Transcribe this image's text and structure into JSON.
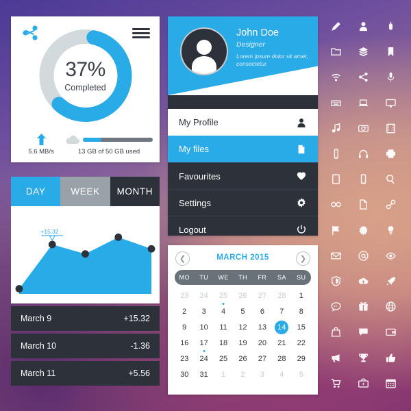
{
  "background": {
    "top_left": "#4b3a96",
    "top_right": "#8a79b5",
    "mid_right": "#cc9180",
    "bottom_right": "#6b2d6b",
    "bottom_left": "#4a2566"
  },
  "accent": "#29abe8",
  "dark": "#2c313a",
  "donut_card": {
    "share_icon": "share-icon",
    "menu_icon": "hamburger-menu-icon",
    "percent_text": "37%",
    "completed_label": "Completed",
    "percent_value": 37,
    "upload_icon": "upload-arrow-icon",
    "upload_speed": "5.6 MB/s",
    "cloud_icon": "cloud-icon",
    "storage_text": "13 GB of 50 GB used",
    "storage_used_gb": 13,
    "storage_total_gb": 50,
    "storage_percent": 26
  },
  "graph_card": {
    "tabs": [
      {
        "label": "DAY",
        "state": "active"
      },
      {
        "label": "WEEK",
        "state": "inactive"
      },
      {
        "label": "MONTH",
        "state": "dark"
      }
    ],
    "tooltip": "+15.32",
    "rows": [
      {
        "date": "March 9",
        "value": "+15.32"
      },
      {
        "date": "March 10",
        "value": "-1.36"
      },
      {
        "date": "March 11",
        "value": "+5.56"
      }
    ]
  },
  "chart_data": {
    "type": "area",
    "title": "",
    "xlabel": "",
    "ylabel": "",
    "x": [
      0,
      1,
      2,
      3,
      4
    ],
    "values": [
      7,
      68,
      55,
      78,
      62
    ],
    "point_labels": [
      "",
      "+15.32",
      "",
      "",
      ""
    ],
    "annotation": "+15.32",
    "grid": false,
    "legend": "none",
    "ylim": [
      0,
      100
    ],
    "series_color": "#29abe8",
    "marker_color": "#2c313a"
  },
  "profile_card": {
    "name": "John Doe",
    "role": "Designer",
    "description": "Lorem ipsum dolor sit amet, consectetur.",
    "avatar_icon": "user-avatar-icon",
    "menu": [
      {
        "label": "My Profile",
        "icon": "user-icon",
        "state": "white"
      },
      {
        "label": "My files",
        "icon": "file-icon",
        "state": "active"
      },
      {
        "label": "Favourites",
        "icon": "heart-icon",
        "state": "dark"
      },
      {
        "label": "Settings",
        "icon": "gear-icon",
        "state": "dark"
      },
      {
        "label": "Logout",
        "icon": "power-icon",
        "state": "dark"
      }
    ]
  },
  "calendar_card": {
    "title": "MARCH 2015",
    "prev_icon": "chevron-left-icon",
    "next_icon": "chevron-right-icon",
    "day_headers": [
      "MO",
      "TU",
      "WE",
      "TH",
      "FR",
      "SA",
      "SU"
    ],
    "selected_day": 14,
    "dot_days": [
      4,
      24
    ],
    "weeks": [
      [
        {
          "n": "23",
          "mut": true
        },
        {
          "n": "24",
          "mut": true
        },
        {
          "n": "25",
          "mut": true
        },
        {
          "n": "26",
          "mut": true
        },
        {
          "n": "27",
          "mut": true
        },
        {
          "n": "28",
          "mut": true
        },
        {
          "n": "1",
          "mut": false
        }
      ],
      [
        {
          "n": "2",
          "mut": false
        },
        {
          "n": "3",
          "mut": false
        },
        {
          "n": "4",
          "mut": false,
          "dot": true
        },
        {
          "n": "5",
          "mut": false
        },
        {
          "n": "6",
          "mut": false
        },
        {
          "n": "7",
          "mut": false
        },
        {
          "n": "8",
          "mut": false
        }
      ],
      [
        {
          "n": "9",
          "mut": false
        },
        {
          "n": "10",
          "mut": false
        },
        {
          "n": "11",
          "mut": false
        },
        {
          "n": "12",
          "mut": false
        },
        {
          "n": "13",
          "mut": false
        },
        {
          "n": "14",
          "mut": false,
          "sel": true
        },
        {
          "n": "15",
          "mut": false
        }
      ],
      [
        {
          "n": "16",
          "mut": false
        },
        {
          "n": "17",
          "mut": false
        },
        {
          "n": "18",
          "mut": false
        },
        {
          "n": "19",
          "mut": false
        },
        {
          "n": "20",
          "mut": false
        },
        {
          "n": "21",
          "mut": false
        },
        {
          "n": "22",
          "mut": false
        }
      ],
      [
        {
          "n": "23",
          "mut": false
        },
        {
          "n": "24",
          "mut": false,
          "dot": true
        },
        {
          "n": "25",
          "mut": false
        },
        {
          "n": "26",
          "mut": false
        },
        {
          "n": "27",
          "mut": false
        },
        {
          "n": "28",
          "mut": false
        },
        {
          "n": "29",
          "mut": false
        }
      ],
      [
        {
          "n": "30",
          "mut": false
        },
        {
          "n": "31",
          "mut": false
        },
        {
          "n": "1",
          "mut": true
        },
        {
          "n": "2",
          "mut": true
        },
        {
          "n": "3",
          "mut": true
        },
        {
          "n": "4",
          "mut": true
        },
        {
          "n": "5",
          "mut": true
        }
      ]
    ]
  },
  "icon_grid": [
    "pencil-icon",
    "user-icon",
    "mouse-icon",
    "folder-icon",
    "layers-icon",
    "bookmark-icon",
    "wifi-icon",
    "share-icon",
    "microphone-icon",
    "keyboard-icon",
    "laptop-icon",
    "monitor-icon",
    "music-note-icon",
    "camera-icon",
    "film-icon",
    "phone-icon",
    "headphones-icon",
    "printer-icon",
    "tablet-icon",
    "smartphone-icon",
    "search-icon",
    "glasses-icon",
    "document-icon",
    "link-icon",
    "flag-icon",
    "gear-icon",
    "lightbulb-icon",
    "envelope-icon",
    "at-sign-icon",
    "eye-icon",
    "shield-icon",
    "cloud-upload-icon",
    "rocket-icon",
    "chat-bubble-icon",
    "gift-box-icon",
    "globe-icon",
    "shopping-bag-icon",
    "speech-bubble-icon",
    "wallet-icon",
    "megaphone-icon",
    "trophy-icon",
    "thumbs-up-icon",
    "shopping-cart-icon",
    "briefcase-icon",
    "calendar-icon"
  ]
}
